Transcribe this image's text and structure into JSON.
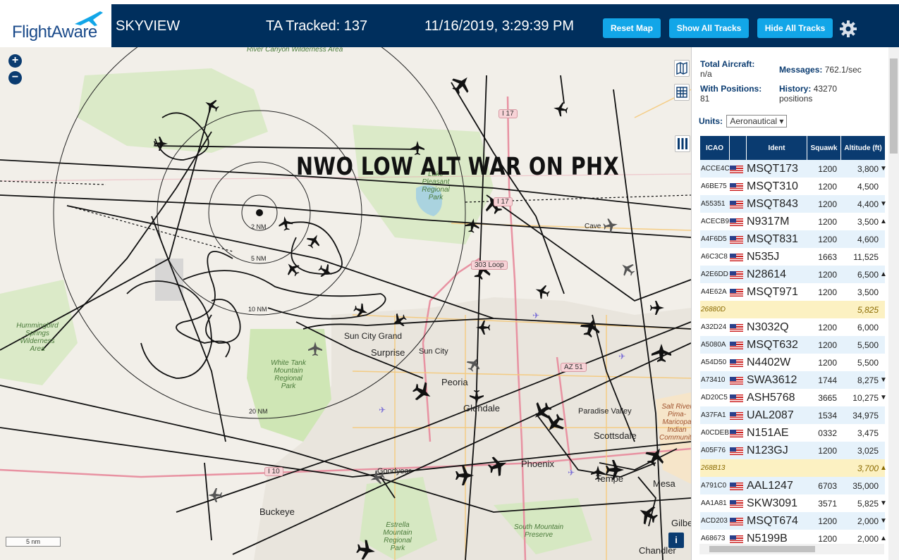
{
  "header": {
    "logo": "FlightAware",
    "app_name": "SKYVIEW",
    "tracked": "TA Tracked: 137",
    "datetime": "11/16/2019, 3:29:39 PM",
    "buttons": {
      "reset_map": "Reset Map",
      "show_all": "Show All Tracks",
      "hide_all": "Hide All Tracks"
    },
    "settings_icon": "gear-icon"
  },
  "map": {
    "overlay_title": "NWO LOW ALT WAR ON PHX",
    "zoom_in": "+",
    "zoom_out": "−",
    "scale": "5 nm",
    "info": "i",
    "rings": [
      "2 NM",
      "5 NM",
      "10 NM",
      "20 NM"
    ],
    "cities": [
      "Sun City Grand",
      "Surprise",
      "Sun City",
      "Peoria",
      "Glendale",
      "Paradise Valley",
      "Scottsdale",
      "Phoenix",
      "Goodyear",
      "Buckeye",
      "Tempe",
      "Mesa",
      "Gilbe",
      "Chandler",
      "Cave"
    ],
    "parks": [
      "River Canyon Wilderness Area",
      "Lake Pleasant Regional Park",
      "Hummingbird Springs Wilderness Area",
      "White Tank Mountain Regional Park",
      "Estrella Mountain Regional Park",
      "South Mountain Preserve",
      "Salt River Pima-Maricopa Indian Community"
    ],
    "highways": [
      "I 17",
      "I 17",
      "303 Loop",
      "AZ 51",
      "I 10"
    ],
    "colors": {
      "land": "#f2efe9",
      "park": "#cfe6b5",
      "urban": "#e8e4dc",
      "track": "#111111",
      "ring": "#222222"
    }
  },
  "sidebar": {
    "total_aircraft_label": "Total Aircraft:",
    "total_aircraft_value": "n/a",
    "messages_label": "Messages:",
    "messages_value": "762.1/sec",
    "with_positions_label": "With Positions:",
    "with_positions_value": "81",
    "history_label": "History:",
    "history_value": "43270 positions",
    "units_label": "Units:",
    "units_value": "Aeronautical",
    "columns": [
      "ICAO",
      "",
      "Ident",
      "Squawk",
      "Altitude (ft)"
    ],
    "rows": [
      {
        "icao": "ACCE4C",
        "ident": "MSQT173",
        "squawk": "1200",
        "alt": "3,800",
        "trend": "▼",
        "flag": true
      },
      {
        "icao": "A6BE75",
        "ident": "MSQT310",
        "squawk": "1200",
        "alt": "4,500",
        "trend": "",
        "flag": true
      },
      {
        "icao": "A55351",
        "ident": "MSQT843",
        "squawk": "1200",
        "alt": "4,400",
        "trend": "▼",
        "flag": true
      },
      {
        "icao": "ACECB9",
        "ident": "N9317M",
        "squawk": "1200",
        "alt": "3,500",
        "trend": "▲",
        "flag": true
      },
      {
        "icao": "A4F6D5",
        "ident": "MSQT831",
        "squawk": "1200",
        "alt": "4,600",
        "trend": "",
        "flag": true
      },
      {
        "icao": "A6C3C8",
        "ident": "N535J",
        "squawk": "1663",
        "alt": "11,525",
        "trend": "",
        "flag": true
      },
      {
        "icao": "A2E6DD",
        "ident": "N28614",
        "squawk": "1200",
        "alt": "6,500",
        "trend": "▲",
        "flag": true
      },
      {
        "icao": "A4E62A",
        "ident": "MSQT971",
        "squawk": "1200",
        "alt": "3,500",
        "trend": "",
        "flag": true
      },
      {
        "icao": "26880D",
        "ident": "",
        "squawk": "",
        "alt": "5,825",
        "trend": "",
        "flag": false,
        "hl": true
      },
      {
        "icao": "A32D24",
        "ident": "N3032Q",
        "squawk": "1200",
        "alt": "6,000",
        "trend": "",
        "flag": true
      },
      {
        "icao": "A5080A",
        "ident": "MSQT632",
        "squawk": "1200",
        "alt": "5,500",
        "trend": "",
        "flag": true
      },
      {
        "icao": "A54D50",
        "ident": "N4402W",
        "squawk": "1200",
        "alt": "5,500",
        "trend": "",
        "flag": true
      },
      {
        "icao": "A73410",
        "ident": "SWA3612",
        "squawk": "1744",
        "alt": "8,275",
        "trend": "▼",
        "flag": true
      },
      {
        "icao": "AD20C5",
        "ident": "ASH5768",
        "squawk": "3665",
        "alt": "10,275",
        "trend": "▼",
        "flag": true
      },
      {
        "icao": "A37FA1",
        "ident": "UAL2087",
        "squawk": "1534",
        "alt": "34,975",
        "trend": "",
        "flag": true
      },
      {
        "icao": "A0CDEB",
        "ident": "N151AE",
        "squawk": "0332",
        "alt": "3,475",
        "trend": "",
        "flag": true
      },
      {
        "icao": "A05F76",
        "ident": "N123GJ",
        "squawk": "1200",
        "alt": "3,025",
        "trend": "",
        "flag": true
      },
      {
        "icao": "268B13",
        "ident": "",
        "squawk": "",
        "alt": "3,700",
        "trend": "▲",
        "flag": false,
        "hl": true
      },
      {
        "icao": "A791C0",
        "ident": "AAL1247",
        "squawk": "6703",
        "alt": "35,000",
        "trend": "",
        "flag": true
      },
      {
        "icao": "AA1A81",
        "ident": "SKW3091",
        "squawk": "3571",
        "alt": "5,825",
        "trend": "▼",
        "flag": true
      },
      {
        "icao": "ACD203",
        "ident": "MSQT674",
        "squawk": "1200",
        "alt": "2,000",
        "trend": "▼",
        "flag": true
      },
      {
        "icao": "A68673",
        "ident": "N5199B",
        "squawk": "1200",
        "alt": "2,000",
        "trend": "▲",
        "flag": true
      }
    ]
  }
}
